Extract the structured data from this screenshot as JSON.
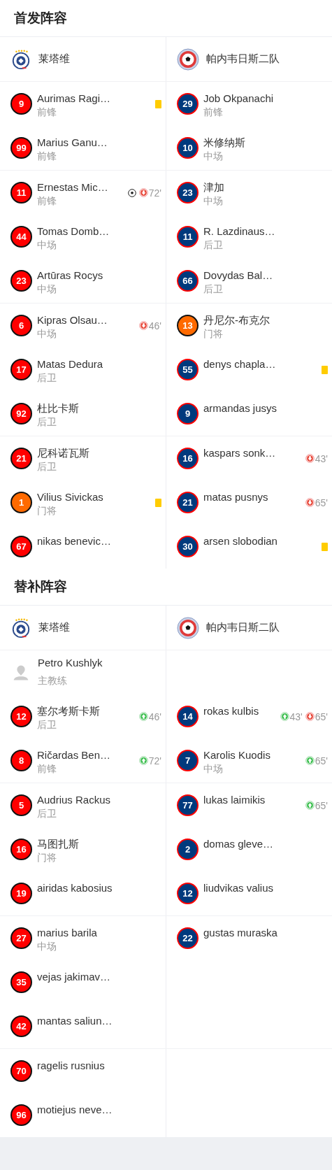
{
  "sections": [
    {
      "title": "首发阵容",
      "teams": [
        {
          "name": "莱塔维",
          "kind": "stars"
        },
        {
          "name": "帕内韦日斯二队",
          "kind": "ball"
        }
      ],
      "rows": [
        {
          "rule_below": false,
          "cells": [
            {
              "kind": "player",
              "number": "9",
              "color": "#ff0000",
              "name": "Aurimas Ragi…",
              "position": "前锋",
              "events": [
                {
                  "kind": "yellow"
                }
              ]
            },
            {
              "kind": "player",
              "number": "29",
              "color": "#003a7d",
              "name": "Job Okpanachi",
              "position": "前锋"
            }
          ]
        },
        {
          "rule_below": true,
          "cells": [
            {
              "kind": "player",
              "number": "99",
              "color": "#ff0000",
              "name": "Marius Ganu…",
              "position": "前锋"
            },
            {
              "kind": "player",
              "number": "10",
              "color": "#003a7d",
              "name": "米修纳斯",
              "position": "中场"
            }
          ]
        },
        {
          "rule_below": false,
          "cells": [
            {
              "kind": "player",
              "number": "11",
              "color": "#ff0000",
              "name": "Ernestas Mic…",
              "position": "前锋",
              "events": [
                {
                  "kind": "goal"
                },
                {
                  "kind": "off",
                  "minute": "72'"
                }
              ]
            },
            {
              "kind": "player",
              "number": "23",
              "color": "#003a7d",
              "name": "津加",
              "position": "中场"
            }
          ]
        },
        {
          "rule_below": false,
          "cells": [
            {
              "kind": "player",
              "number": "44",
              "color": "#ff0000",
              "name": "Tomas Domb…",
              "position": "中场"
            },
            {
              "kind": "player",
              "number": "11",
              "color": "#003a7d",
              "name": "R. Lazdinaus…",
              "position": "后卫"
            }
          ]
        },
        {
          "rule_below": true,
          "cells": [
            {
              "kind": "player",
              "number": "23",
              "color": "#ff0000",
              "name": "Artūras Rocys",
              "position": "中场"
            },
            {
              "kind": "player",
              "number": "66",
              "color": "#003a7d",
              "name": "Dovydas Bal…",
              "position": "后卫"
            }
          ]
        },
        {
          "rule_below": false,
          "cells": [
            {
              "kind": "player",
              "number": "6",
              "color": "#ff0000",
              "name": "Kipras Olsau…",
              "position": "中场",
              "events": [
                {
                  "kind": "off",
                  "minute": "46'"
                }
              ]
            },
            {
              "kind": "player",
              "number": "13",
              "color": "#ff6a00",
              "name": "丹尼尔-布克尔",
              "position": "门将"
            }
          ]
        },
        {
          "rule_below": false,
          "cells": [
            {
              "kind": "player",
              "number": "17",
              "color": "#ff0000",
              "name": "Matas Dedura",
              "position": "后卫"
            },
            {
              "kind": "player",
              "number": "55",
              "color": "#003a7d",
              "name": "denys chapla…",
              "events": [
                {
                  "kind": "yellow"
                }
              ]
            }
          ]
        },
        {
          "rule_below": true,
          "cells": [
            {
              "kind": "player",
              "number": "92",
              "color": "#ff0000",
              "name": "杜比卡斯",
              "position": "后卫"
            },
            {
              "kind": "player",
              "number": "9",
              "color": "#003a7d",
              "name": "armandas jusys"
            }
          ]
        },
        {
          "rule_below": false,
          "cells": [
            {
              "kind": "player",
              "number": "21",
              "color": "#ff0000",
              "name": "尼科诺瓦斯",
              "position": "后卫"
            },
            {
              "kind": "player",
              "number": "16",
              "color": "#003a7d",
              "name": "kaspars sonk…",
              "events": [
                {
                  "kind": "off",
                  "minute": "43'"
                }
              ]
            }
          ]
        },
        {
          "rule_below": false,
          "cells": [
            {
              "kind": "player",
              "number": "1",
              "color": "#ff6a00",
              "name": "Vilius Sivickas",
              "position": "门将",
              "events": [
                {
                  "kind": "yellow"
                }
              ]
            },
            {
              "kind": "player",
              "number": "21",
              "color": "#003a7d",
              "name": "matas pusnys",
              "events": [
                {
                  "kind": "off",
                  "minute": "65'"
                }
              ]
            }
          ]
        },
        {
          "rule_below": false,
          "cells": [
            {
              "kind": "player",
              "number": "67",
              "color": "#ff0000",
              "name": "nikas benevic…"
            },
            {
              "kind": "player",
              "number": "30",
              "color": "#003a7d",
              "name": "arsen slobodian",
              "events": [
                {
                  "kind": "yellow"
                }
              ]
            }
          ]
        }
      ]
    },
    {
      "title": "替补阵容",
      "teams": [
        {
          "name": "莱塔维",
          "kind": "stars"
        },
        {
          "name": "帕内韦日斯二队",
          "kind": "ball"
        }
      ],
      "rows": [
        {
          "rule_below": false,
          "cells": [
            {
              "kind": "coach",
              "name": "Petro Kushlyk",
              "position": "主教练"
            },
            {
              "kind": "empty"
            }
          ]
        },
        {
          "rule_below": false,
          "cells": [
            {
              "kind": "player",
              "number": "12",
              "color": "#ff0000",
              "name": "塞尔考斯卡斯",
              "position": "后卫",
              "events": [
                {
                  "kind": "on",
                  "minute": "46'"
                }
              ]
            },
            {
              "kind": "player",
              "number": "14",
              "color": "#003a7d",
              "name": "rokas kulbis",
              "events": [
                {
                  "kind": "on",
                  "minute": "43'"
                },
                {
                  "kind": "off",
                  "minute": "65'"
                }
              ]
            }
          ]
        },
        {
          "rule_below": true,
          "cells": [
            {
              "kind": "player",
              "number": "8",
              "color": "#ff0000",
              "name": "Ričardas Ben…",
              "position": "前锋",
              "events": [
                {
                  "kind": "on",
                  "minute": "72'"
                }
              ]
            },
            {
              "kind": "player",
              "number": "7",
              "color": "#003a7d",
              "name": "Karolis Kuodis",
              "position": "中场",
              "events": [
                {
                  "kind": "on",
                  "minute": "65'"
                }
              ]
            }
          ]
        },
        {
          "rule_below": false,
          "cells": [
            {
              "kind": "player",
              "number": "5",
              "color": "#ff0000",
              "name": "Audrius Rackus",
              "position": "后卫"
            },
            {
              "kind": "player",
              "number": "77",
              "color": "#003a7d",
              "name": "lukas laimikis",
              "events": [
                {
                  "kind": "on",
                  "minute": "65'"
                }
              ]
            }
          ]
        },
        {
          "rule_below": false,
          "cells": [
            {
              "kind": "player",
              "number": "16",
              "color": "#ff0000",
              "name": "马图扎斯",
              "position": "门将"
            },
            {
              "kind": "player",
              "number": "2",
              "color": "#003a7d",
              "name": "domas gleve…"
            }
          ]
        },
        {
          "rule_below": true,
          "cells": [
            {
              "kind": "player",
              "number": "19",
              "color": "#ff0000",
              "name": "airidas kabosius"
            },
            {
              "kind": "player",
              "number": "12",
              "color": "#003a7d",
              "name": "liudvikas valius"
            }
          ]
        },
        {
          "rule_below": false,
          "cells": [
            {
              "kind": "player",
              "number": "27",
              "color": "#ff0000",
              "name": "marius barila",
              "position": "中场"
            },
            {
              "kind": "player",
              "number": "22",
              "color": "#003a7d",
              "name": "gustas muraska"
            }
          ]
        },
        {
          "rule_below": false,
          "cells": [
            {
              "kind": "player",
              "number": "35",
              "color": "#ff0000",
              "name": "vejas jakimav…"
            },
            {
              "kind": "empty"
            }
          ]
        },
        {
          "rule_below": true,
          "cells": [
            {
              "kind": "player",
              "number": "42",
              "color": "#ff0000",
              "name": "mantas saliun…"
            },
            {
              "kind": "empty"
            }
          ]
        },
        {
          "rule_below": false,
          "cells": [
            {
              "kind": "player",
              "number": "70",
              "color": "#ff0000",
              "name": "ragelis rusnius"
            },
            {
              "kind": "empty"
            }
          ]
        },
        {
          "rule_below": false,
          "cells": [
            {
              "kind": "player",
              "number": "96",
              "color": "#ff0000",
              "name": "motiejus neve…"
            },
            {
              "kind": "empty"
            }
          ]
        }
      ]
    }
  ]
}
